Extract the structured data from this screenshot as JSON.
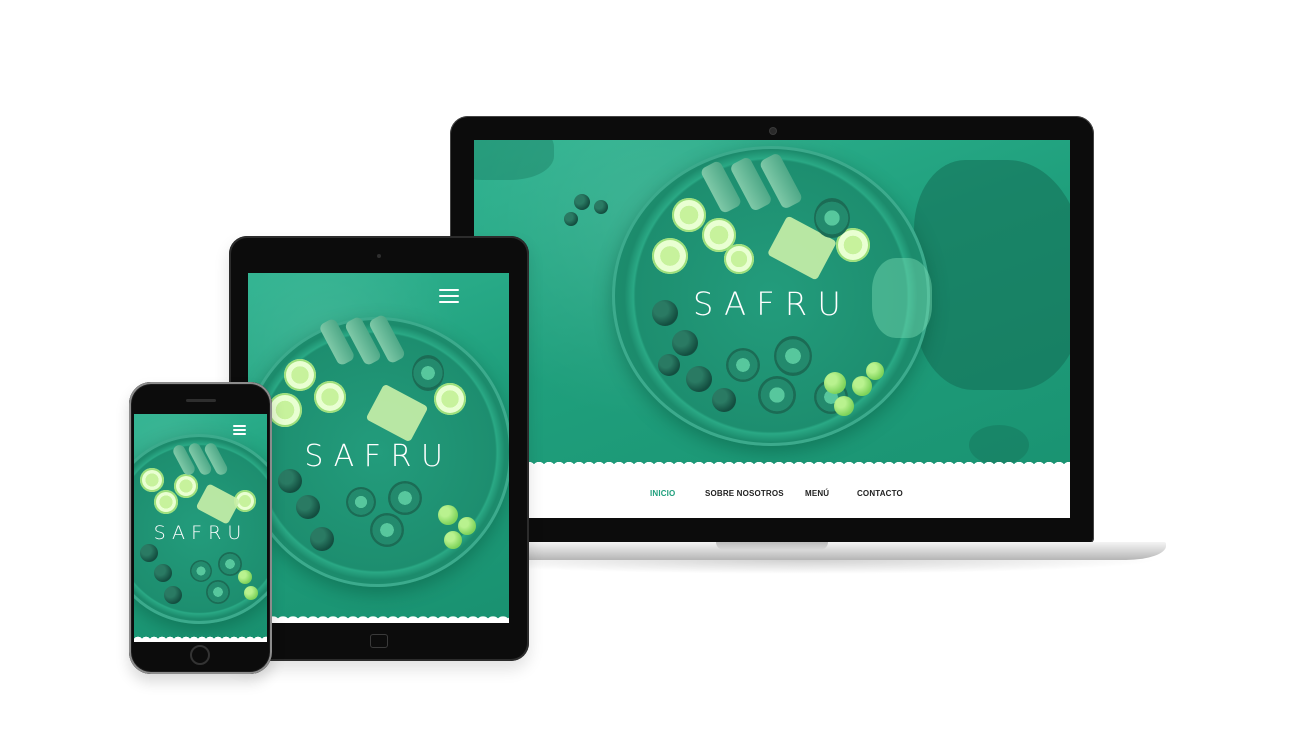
{
  "brand": {
    "logo_text": "SAFRU"
  },
  "laptop_site": {
    "nav": [
      {
        "label": "INICIO",
        "active": true
      },
      {
        "label": "SOBRE NOSOTROS",
        "active": false
      },
      {
        "label": "MENÚ",
        "active": false
      },
      {
        "label": "CONTACTO",
        "active": false
      }
    ]
  },
  "icons": {
    "menu": "hamburger-menu-icon"
  },
  "colors": {
    "accent": "#1f9f7c",
    "overlay_green": "#2fb390",
    "nav_text": "#222222"
  }
}
